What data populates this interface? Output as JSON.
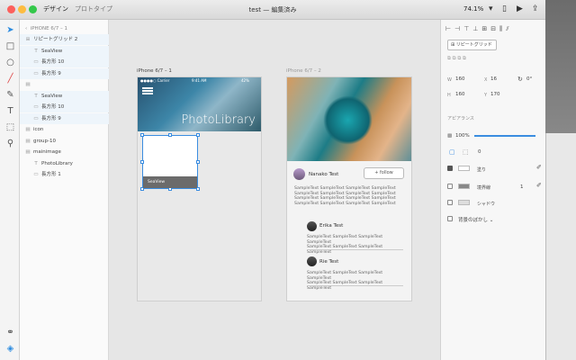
{
  "titlebar": {
    "tabs": [
      "デザイン",
      "プロトタイプ"
    ],
    "title": "test — 編集済み",
    "zoom": "74.1%",
    "icons": [
      "device-preview-icon",
      "play-icon",
      "share-icon"
    ]
  },
  "tools": [
    "select-arrow-icon",
    "rectangle-icon",
    "ellipse-icon",
    "line-icon",
    "pen-icon",
    "text-icon",
    "artboard-icon",
    "zoom-icon",
    "symbols-icon",
    "layers-icon"
  ],
  "layers": {
    "breadcrumb": "iPHONE 6/7 – 1",
    "rows": [
      {
        "label": "リピートグリッド 2",
        "icon": "grid-icon",
        "indent": 0,
        "selected": true
      },
      {
        "label": "SeaView",
        "icon": "text-icon",
        "indent": 1,
        "selected": true
      },
      {
        "label": "長方形 10",
        "icon": "rect-icon",
        "indent": 1,
        "selected": true
      },
      {
        "label": "長方形 9",
        "icon": "rect-icon",
        "indent": 1,
        "selected": true
      },
      {
        "label": "",
        "icon": "folder-icon",
        "indent": 0,
        "selected": false
      },
      {
        "label": "SeaView",
        "icon": "text-icon",
        "indent": 1,
        "selected": true
      },
      {
        "label": "長方形 10",
        "icon": "rect-icon",
        "indent": 1,
        "selected": true
      },
      {
        "label": "長方形 9",
        "icon": "rect-icon",
        "indent": 1,
        "selected": true
      },
      {
        "label": "icon",
        "icon": "folder-icon",
        "indent": 0,
        "selected": false
      },
      {
        "label": "group-10",
        "icon": "folder-icon",
        "indent": 0,
        "selected": false
      },
      {
        "label": "mainimage",
        "icon": "folder-icon",
        "indent": 0,
        "selected": false
      },
      {
        "label": "PhotoLibrary",
        "icon": "text-icon",
        "indent": 1,
        "selected": false
      },
      {
        "label": "長方形 1",
        "icon": "rect-icon",
        "indent": 1,
        "selected": false
      }
    ]
  },
  "canvas": {
    "artboard1": {
      "label": "iPhone 6/7 – 1",
      "status_left": "●●●●○ Carrier",
      "status_center": "9:41 AM",
      "status_right": "42%",
      "hero_title": "PhotoLibrary",
      "cell_label": "SeaView"
    },
    "artboard2": {
      "label": "iPhone 6/7 – 2",
      "profile_name": "Nanako Test",
      "follow_label": "+ follow",
      "sample_lines": [
        "SampleText SampleText SampleText SampleText",
        "SampleText SampleText SampleText SampleText",
        "SampleText SampleText SampleText SampleText",
        "SampleText SampleText SampleText SampleText"
      ],
      "comment1_name": "Erika Test",
      "comment1_lines": [
        "SampleText SampleText SampleText SampleText",
        "SampleText SampleText SampleText SampleText"
      ],
      "comment2_name": "Rie Test",
      "comment2_lines": [
        "SampleText SampleText SampleText SampleText",
        "SampleText SampleText SampleText SampleText"
      ]
    }
  },
  "properties": {
    "repeat_grid_label": "リピートグリッド",
    "w_label": "W",
    "w_value": "160",
    "x_label": "X",
    "x_value": "16",
    "rotation": "0°",
    "h_label": "H",
    "h_value": "160",
    "y_label": "Y",
    "y_value": "170",
    "appearance_header": "アピアランス",
    "opacity": "100%",
    "opacity_fraction": 1.0,
    "corner_radius": "0",
    "fill_label": "塗り",
    "border_label": "境界線",
    "border_width": "1",
    "shadow_label": "シャドウ",
    "blur_label": "背景のぼかし",
    "fill_checked": true,
    "border_checked": false,
    "shadow_checked": false,
    "blur_checked": false
  }
}
